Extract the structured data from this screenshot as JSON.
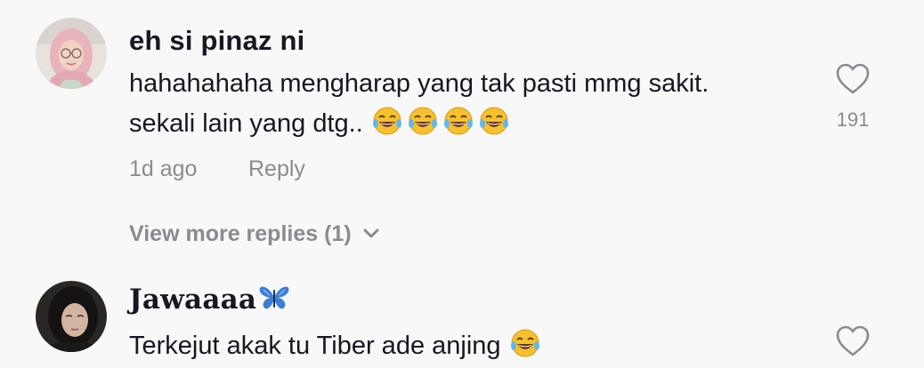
{
  "comments": [
    {
      "username": "eh si pinaz ni",
      "text_lines": [
        "hahahahaha mengharap yang tak pasti mmg sakit.",
        "sekali lain yang dtg.."
      ],
      "emoji_count": 4,
      "like_count": "191",
      "time": "1d ago",
      "reply_label": "Reply",
      "avatar_icon": "user-avatar-hijab-pink",
      "heart_icon": "heart-outline-icon",
      "view_more_replies": "View more replies (1)"
    },
    {
      "username": "Jawaaaa",
      "username_emoji": "butterfly-icon",
      "text": "Terkejut akak tu Tiber ade anjing",
      "emoji_count": 1,
      "avatar_icon": "user-avatar-hijab-black",
      "heart_icon": "heart-outline-icon"
    }
  ],
  "colors": {
    "background": "#f8f8f8",
    "primary_text": "#161823",
    "secondary_text": "#8a8b91",
    "butterfly": "#3b7ed8"
  }
}
